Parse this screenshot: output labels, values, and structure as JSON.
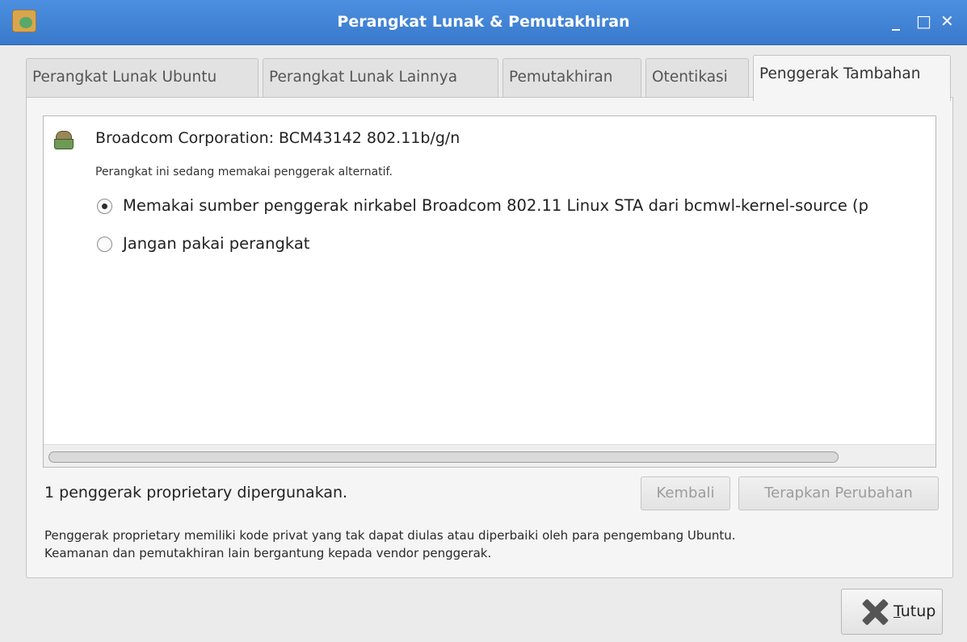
{
  "window": {
    "title": "Perangkat Lunak & Pemutakhiran",
    "controls": {
      "minimize": "_",
      "maximize": "□",
      "close": "✕"
    }
  },
  "tabs": [
    {
      "label": "Perangkat Lunak Ubuntu",
      "active": false
    },
    {
      "label": "Perangkat Lunak Lainnya",
      "active": false
    },
    {
      "label": "Pemutakhiran",
      "active": false
    },
    {
      "label": "Otentikasi",
      "active": false
    },
    {
      "label": "Penggerak Tambahan",
      "active": true
    }
  ],
  "device": {
    "name": "Broadcom Corporation: BCM43142 802.11b/g/n",
    "status": "Perangkat ini sedang memakai penggerak alternatif.",
    "options": [
      {
        "label": "Memakai sumber penggerak nirkabel Broadcom 802.11 Linux STA dari bcmwl-kernel-source (p",
        "selected": true
      },
      {
        "label": "Jangan pakai perangkat",
        "selected": false
      }
    ]
  },
  "status_text": "1 penggerak proprietary dipergunakan.",
  "buttons": {
    "revert": "Kembali",
    "apply": "Terapkan Perubahan",
    "close_mnemonic": "T",
    "close_rest": "utup"
  },
  "note": {
    "line1": "Penggerak proprietary memiliki kode privat yang tak dapat diulas atau diperbaiki oleh para pengembang Ubuntu.",
    "line2": "Keamanan dan pemutakhiran lain bergantung kepada vendor penggerak."
  },
  "icons": {
    "app": "software-properties-icon",
    "device": "wireless-device-icon",
    "close": "close-x-icon"
  }
}
